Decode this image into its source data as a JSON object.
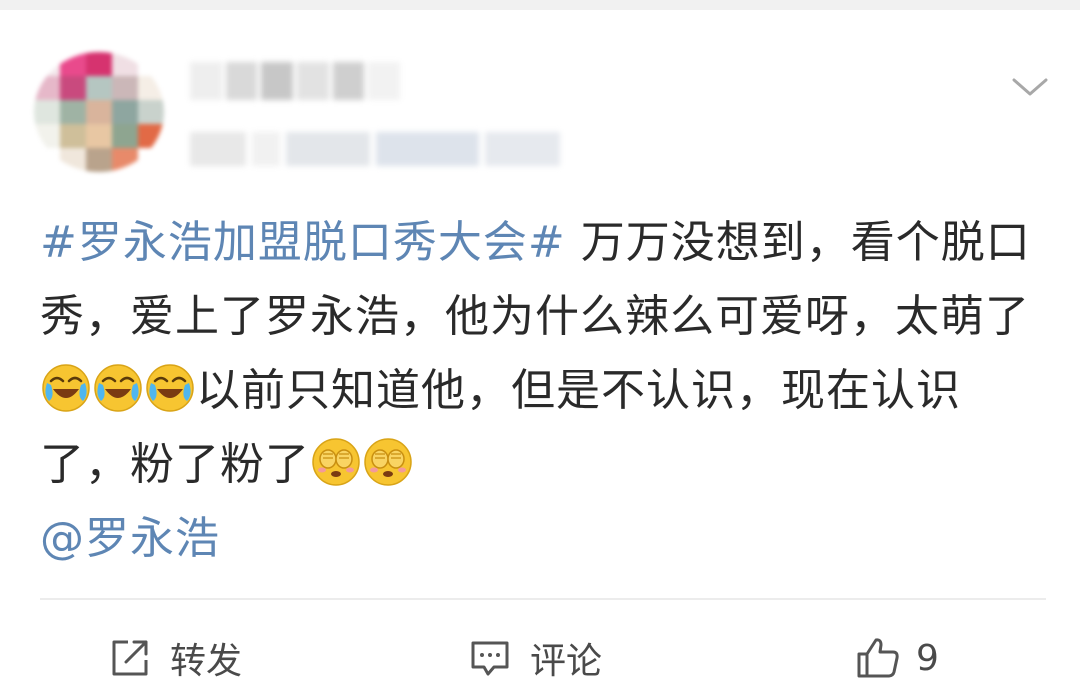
{
  "post": {
    "hashtag": "#罗永浩加盟脱口秀大会#",
    "text_1": " 万万没想到，看个脱口秀，爱上了罗永浩，他为什么辣么可爱呀，太萌了",
    "text_2": "以前只知道他，但是不认识，现在认识了，粉了粉了",
    "mention": "@罗永浩",
    "emojis": [
      "laughing-crying-emoji",
      "covering-face-emoji"
    ]
  },
  "actions": {
    "repost_label": "转发",
    "comment_label": "评论",
    "like_count": "9"
  },
  "colors": {
    "link": "#5e86b4",
    "text": "#2a2a2a",
    "action_text": "#4a4a4a",
    "divider": "#ececec",
    "emoji_yellow": "#f7c531"
  },
  "icons": {
    "options": "chevron-down-icon",
    "repost": "repost-icon",
    "comment": "comment-icon",
    "like": "thumbs-up-icon"
  }
}
